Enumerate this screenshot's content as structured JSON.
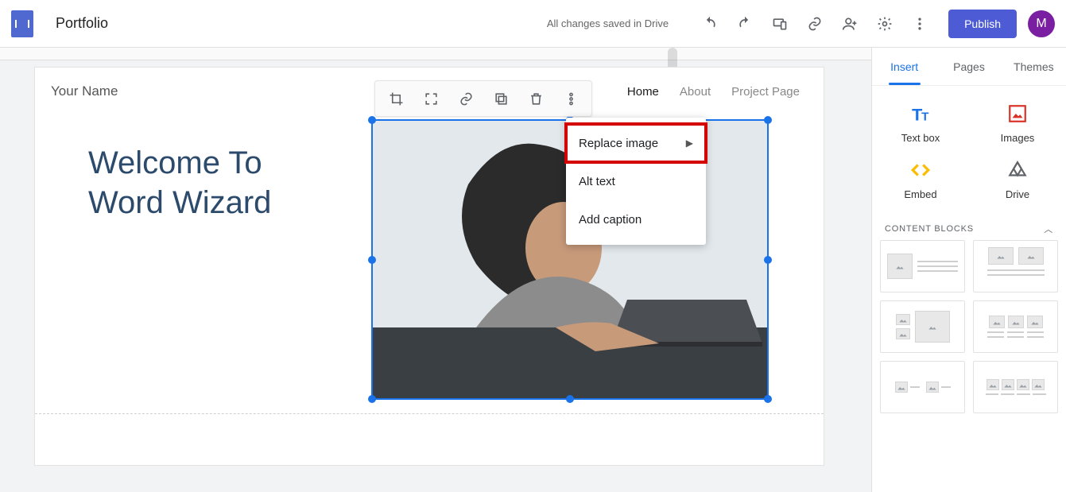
{
  "app": {
    "doc_title": "Portfolio",
    "save_status": "All changes saved in Drive",
    "publish_label": "Publish",
    "avatar_initial": "M"
  },
  "toolbar_icons": {
    "undo": "undo-icon",
    "redo": "redo-icon",
    "devices": "devices-icon",
    "link": "link-icon",
    "share": "person-add-icon",
    "settings": "gear-icon",
    "more": "more-vert-icon"
  },
  "canvas": {
    "your_name": "Your Name",
    "hero_line1": "Welcome To",
    "hero_line2": "Word Wizard",
    "nav": [
      "Home",
      "About",
      "Project Page"
    ]
  },
  "image_toolbar": {
    "crop": "crop-icon",
    "uncrop": "fullscreen-icon",
    "link": "link-icon",
    "copy": "copy-icon",
    "delete": "trash-icon",
    "more": "more-vert-icon"
  },
  "context_menu": {
    "replace": "Replace image",
    "alt": "Alt text",
    "caption": "Add caption"
  },
  "side": {
    "tabs": {
      "insert": "Insert",
      "pages": "Pages",
      "themes": "Themes"
    },
    "cells": {
      "textbox": "Text box",
      "images": "Images",
      "embed": "Embed",
      "drive": "Drive"
    },
    "content_blocks": "CONTENT BLOCKS"
  }
}
